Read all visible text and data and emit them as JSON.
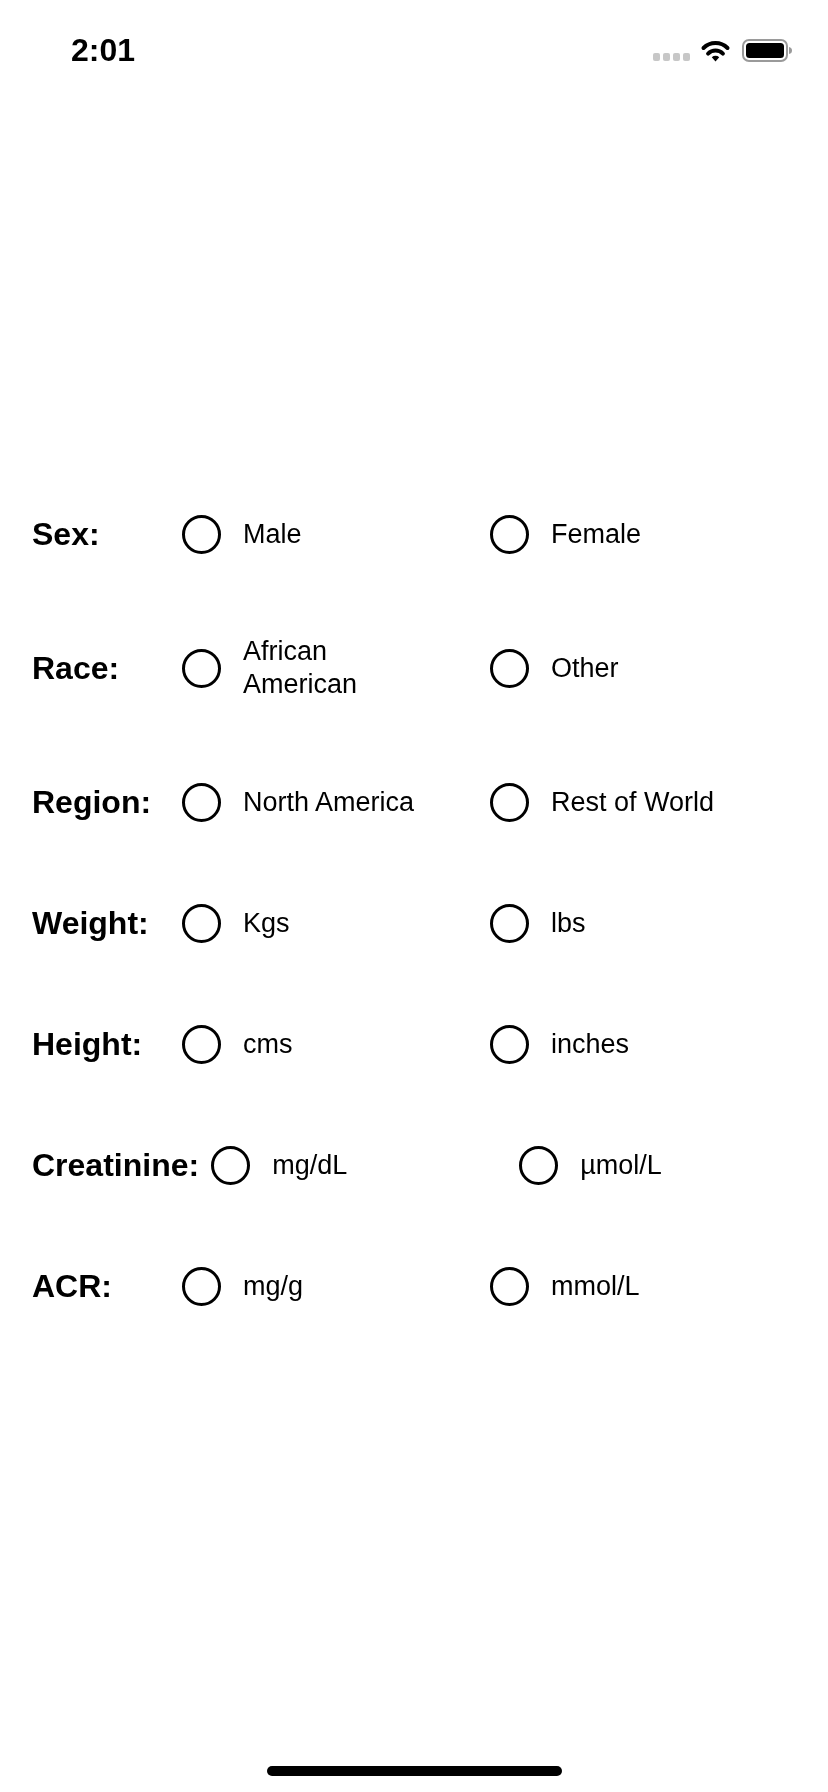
{
  "status_bar": {
    "time": "2:01"
  },
  "form": {
    "rows": [
      {
        "label": "Sex:",
        "options": [
          {
            "label": "Male",
            "selected": false
          },
          {
            "label": "Female",
            "selected": false
          }
        ]
      },
      {
        "label": "Race:",
        "options": [
          {
            "label": "African American",
            "selected": false
          },
          {
            "label": "Other",
            "selected": false
          }
        ]
      },
      {
        "label": "Region:",
        "options": [
          {
            "label": "North America",
            "selected": false
          },
          {
            "label": "Rest of World",
            "selected": false
          }
        ]
      },
      {
        "label": "Weight:",
        "options": [
          {
            "label": "Kgs",
            "selected": false
          },
          {
            "label": "lbs",
            "selected": false
          }
        ]
      },
      {
        "label": "Height:",
        "options": [
          {
            "label": "cms",
            "selected": false
          },
          {
            "label": "inches",
            "selected": false
          }
        ]
      },
      {
        "label": "Creatinine:",
        "options": [
          {
            "label": "mg/dL",
            "selected": false
          },
          {
            "label": "µmol/L",
            "selected": false
          }
        ]
      },
      {
        "label": "ACR:",
        "options": [
          {
            "label": "mg/g",
            "selected": false
          },
          {
            "label": "mmol/L",
            "selected": false
          }
        ]
      }
    ]
  }
}
